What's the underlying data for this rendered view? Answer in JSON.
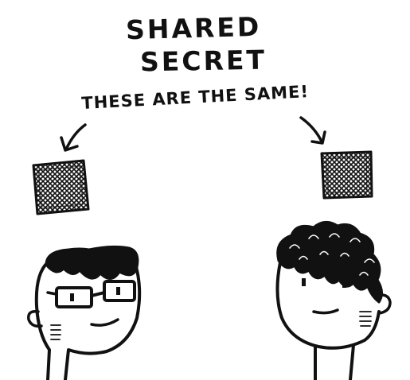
{
  "title": {
    "line1": "SHARED",
    "line2": "SECRET"
  },
  "caption": "THESE ARE THE SAME!",
  "icons": {
    "left_arrow": "curved-arrow-down-left-icon",
    "right_arrow": "curved-arrow-down-right-icon",
    "left_secret": "scribbled-square-secret-icon",
    "right_secret": "scribbled-square-secret-icon",
    "left_person": "person-with-glasses-icon",
    "right_person": "person-with-curly-hair-icon"
  },
  "colors": {
    "ink": "#111111",
    "paper": "#ffffff"
  }
}
